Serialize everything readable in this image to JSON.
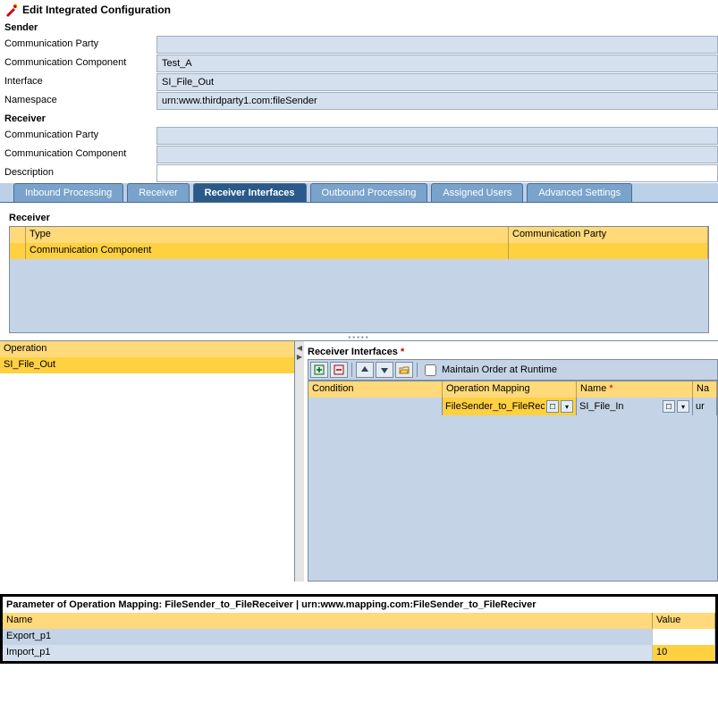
{
  "title": "Edit Integrated Configuration",
  "sender": {
    "section": "Sender",
    "comm_party_label": "Communication Party",
    "comm_party": "",
    "comm_comp_label": "Communication Component",
    "comm_comp": "Test_A",
    "interface_label": "Interface",
    "interface": "SI_File_Out",
    "namespace_label": "Namespace",
    "namespace": "urn:www.thirdparty1.com:fileSender"
  },
  "receiver": {
    "section": "Receiver",
    "comm_party_label": "Communication Party",
    "comm_party": "",
    "comm_comp_label": "Communication Component",
    "comm_comp": "",
    "description_label": "Description",
    "description": ""
  },
  "tabs": [
    "Inbound Processing",
    "Receiver",
    "Receiver Interfaces",
    "Outbound Processing",
    "Assigned Users",
    "Advanced Settings"
  ],
  "active_tab": 2,
  "receiver_box": {
    "label": "Receiver",
    "col_type": "Type",
    "col_party": "Communication Party",
    "row_type": "Communication Component"
  },
  "operation": {
    "header": "Operation",
    "value": "SI_File_Out"
  },
  "ri": {
    "title": "Receiver Interfaces",
    "maintain": "Maintain Order at Runtime",
    "cols": {
      "condition": "Condition",
      "opmap": "Operation Mapping",
      "name": "Name",
      "ns": "Na"
    },
    "row": {
      "condition": "",
      "opmap": "FileSender_to_FileRec",
      "name": "SI_File_In",
      "ns": "ur"
    }
  },
  "param": {
    "title": "Parameter of Operation Mapping: FileSender_to_FileReceiver | urn:www.mapping.com:FileSender_to_FileReciver",
    "col_name": "Name",
    "col_value": "Value",
    "rows": [
      {
        "name": "Export_p1",
        "value": ""
      },
      {
        "name": "Import_p1",
        "value": "10"
      }
    ]
  }
}
